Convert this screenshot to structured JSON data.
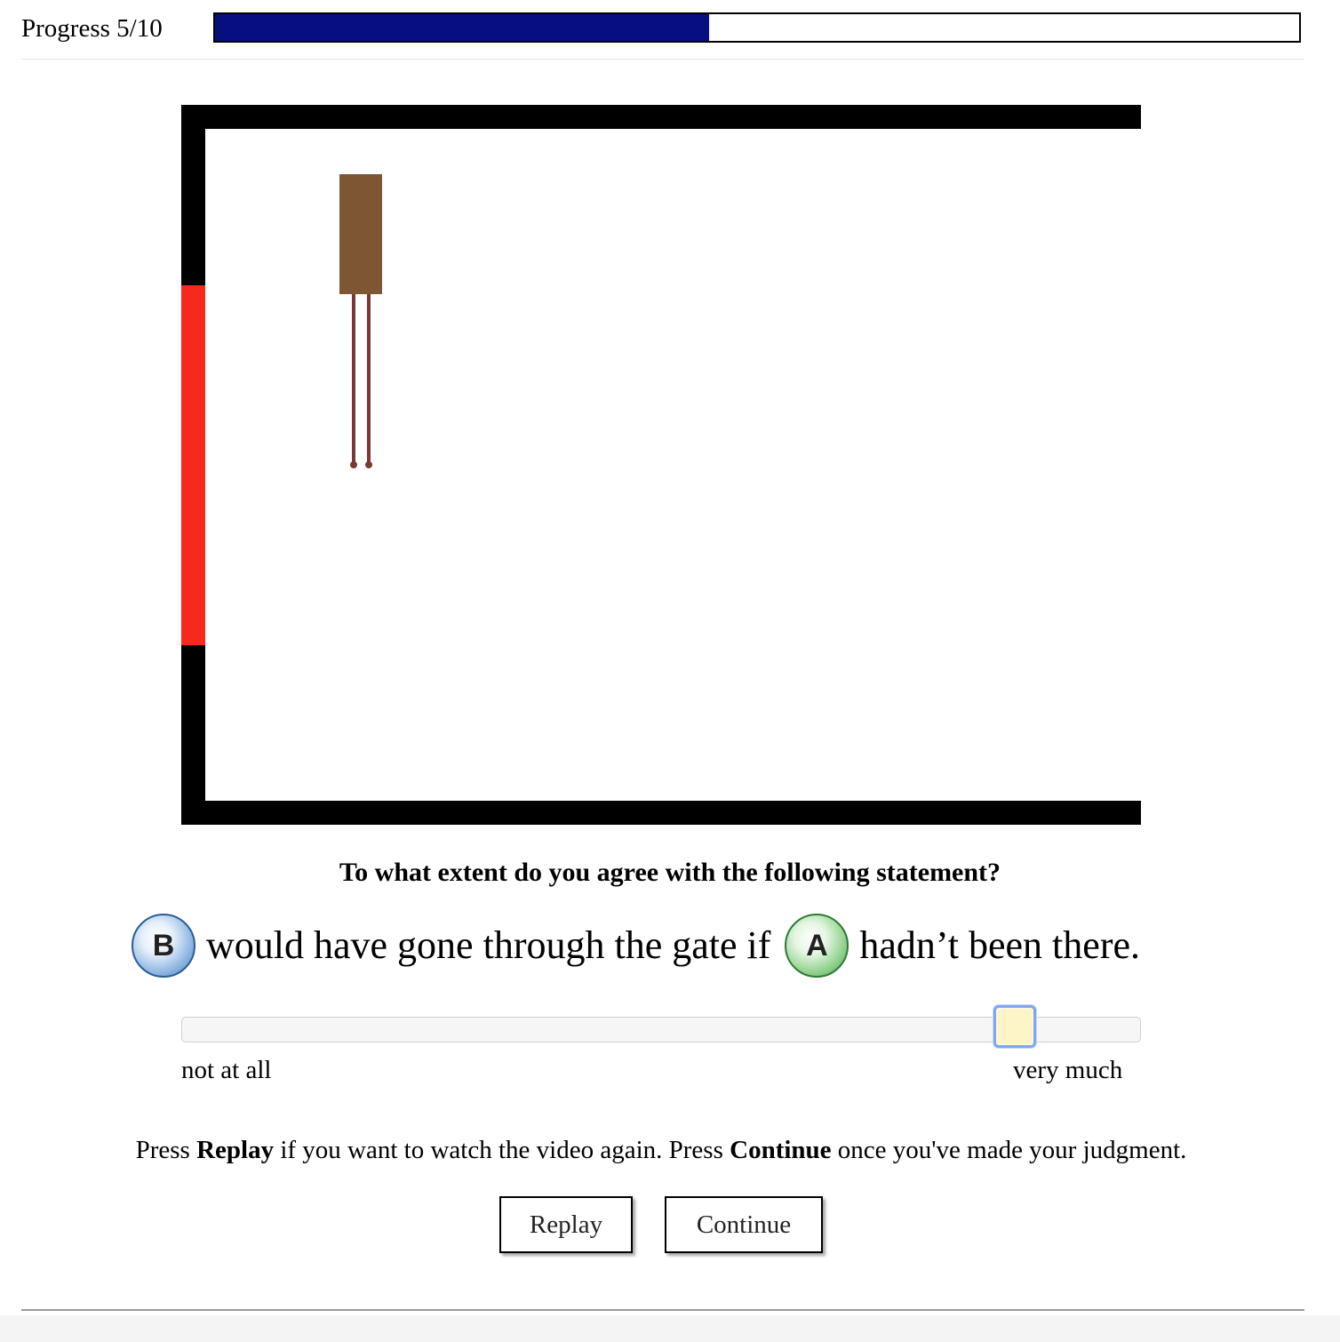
{
  "progress": {
    "label": "Progress 5/10",
    "current": 5,
    "total": 10
  },
  "question": "To what extent do you agree with the following statement?",
  "statement": {
    "ball_b": "B",
    "middle": "would have gone through the gate if",
    "ball_a": "A",
    "end": "hadn’t been there."
  },
  "slider": {
    "min_label": "not at all",
    "max_label": "very much",
    "value_fraction": 0.87
  },
  "instructions": {
    "press1": "Press",
    "replay_word": "Replay",
    "mid": "if you want to watch the video again. Press",
    "continue_word": "Continue",
    "end": "once you've made your judgment."
  },
  "buttons": {
    "replay": "Replay",
    "continue": "Continue"
  },
  "colors": {
    "progress_fill": "#050f7f",
    "wall": "#000000",
    "gate": "#f52a1d",
    "block": "#7d5634",
    "legs": "#7a3a32"
  }
}
